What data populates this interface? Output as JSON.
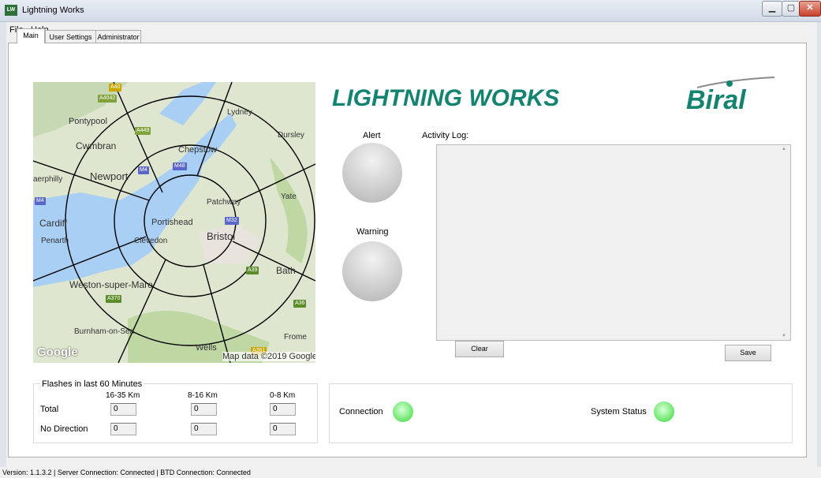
{
  "window": {
    "title": "Lightning Works",
    "icon": "LW"
  },
  "menu": [
    "File",
    "Help"
  ],
  "tabs": [
    "Main",
    "User Settings",
    "Administrator"
  ],
  "map": {
    "places": {
      "pontypool": "Pontypool",
      "cwmbran": "Cwmbran",
      "newport": "Newport",
      "caerphilly": "aerphilly",
      "cardiff": "Cardiff",
      "penarth": "Penarth",
      "chepstow": "Chepstow",
      "lydney": "Lydney",
      "dursley": "Dursley",
      "yate": "Yate",
      "patchway": "Patchway",
      "portishead": "Portishead",
      "bristol": "Bristol",
      "clevedon": "Clevedon",
      "bath": "Bath",
      "weston": "Weston-super-Mare",
      "burnham": "Burnham-on-Sea",
      "wells": "Wells",
      "frome": "Frome"
    },
    "roads": {
      "a40": "A40",
      "a4042": "A4042",
      "a449": "A449",
      "m4_left": "M4",
      "m4_center": "M4",
      "m48": "M48",
      "m32": "M32",
      "a39": "A39",
      "a370": "A370",
      "a36": "A36",
      "a361": "A361"
    },
    "logo": "Google",
    "attribution": "Map data ©2019 Google"
  },
  "brand": {
    "title": "LIGHTNING WORKS",
    "logo": "Biral"
  },
  "alert_label": "Alert",
  "warning_label": "Warning",
  "log": {
    "label": "Activity Log:",
    "content": "",
    "scroll_up_icon": "scroll-up-arrow-icon",
    "scroll_down_icon": "scroll-down-arrow-icon"
  },
  "buttons": {
    "clear": "Clear",
    "save": "Save"
  },
  "flashes": {
    "title": "Flashes in last",
    "minutes": "60 Minutes",
    "columns": [
      "16-35 Km",
      "8-16 Km",
      "0-8 Km"
    ],
    "rows": [
      {
        "label": "Total",
        "values": [
          "0",
          "0",
          "0"
        ]
      },
      {
        "label": "No Direction",
        "values": [
          "0",
          "0",
          "0"
        ]
      }
    ]
  },
  "connection_label": "Connection",
  "system_status_label": "System Status",
  "statusbar": {
    "text": "Version:  1.1.3.2  |  Server Connection:  Connected  |  BTD Connection:  Connected"
  },
  "colors": {
    "brand": "#14836f",
    "lamp_ok": "#6de76d",
    "water": "#a9cff5",
    "land": "#dfe6cf"
  }
}
